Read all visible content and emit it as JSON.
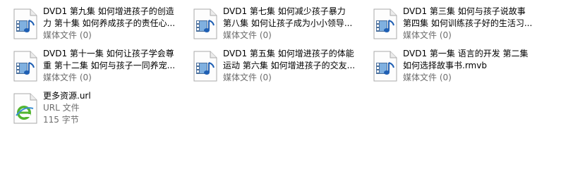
{
  "files": [
    {
      "line1": "DVD1 第九集 如何增进孩子的创造",
      "line2": "力 第十集 如何养成孩子的责任心...",
      "line3": "媒体文件 (0)",
      "icon": "media-file-icon"
    },
    {
      "line1": "DVD1 第七集 如何减少孩子暴力",
      "line2": "第八集 如何让孩子成为小小领导...",
      "line3": "媒体文件 (0)",
      "icon": "media-file-icon"
    },
    {
      "line1": "DVD1 第三集 如何与孩子说故事",
      "line2": "第四集 如何训练孩子好的生活习...",
      "line3": "媒体文件 (0)",
      "icon": "media-file-icon"
    },
    {
      "line1": "DVD1 第十一集 如何让孩子学会尊",
      "line2": "重 第十二集 如何与孩子一同养宠...",
      "line3": "媒体文件 (0)",
      "icon": "media-file-icon"
    },
    {
      "line1": "DVD1 第五集 如何增进孩子的体能",
      "line2": "运动 第六集 如何增进孩子的交友...",
      "line3": "媒体文件 (0)",
      "icon": "media-file-icon"
    },
    {
      "line1": "DVD1 第一集 语言的开发 第二集",
      "line2": "如何选择故事书.rmvb",
      "line3": "媒体文件 (0)",
      "icon": "media-file-icon"
    },
    {
      "line1": "更多资源.url",
      "line2": "URL 文件",
      "line3": "115 字节",
      "icon": "internet-shortcut-icon"
    }
  ]
}
